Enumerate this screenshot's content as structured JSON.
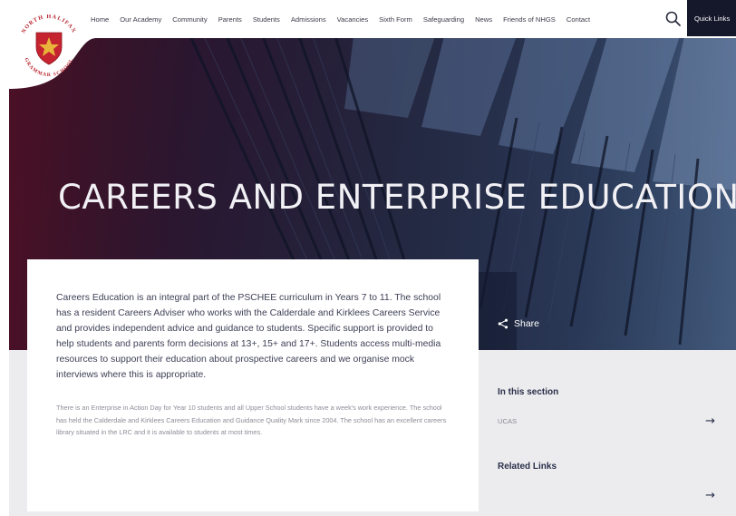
{
  "school": {
    "crest_text_top": "NORTH HALIFAX",
    "crest_text_bottom": "GRAMMAR SCHOOL"
  },
  "nav": {
    "items": [
      "Home",
      "Our Academy",
      "Community",
      "Parents",
      "Students",
      "Admissions",
      "Vacancies",
      "Sixth Form",
      "Safeguarding",
      "News",
      "Friends of NHGS",
      "Contact"
    ],
    "search_icon": "search-icon",
    "quick_links_label": "Quick Links"
  },
  "hero": {
    "title": "CAREERS AND ENTERPRISE EDUCATION"
  },
  "content": {
    "main_text": "Careers Education is an integral part of the PSCHEE curriculum in Years 7 to 11. The school has a resident Careers Adviser who works with the Calderdale and Kirklees Careers Service and provides independent advice and guidance to students. Specific support is provided to help students and parents form decisions at 13+, 15+ and 17+.  Students access multi-media resources to support their education about prospective careers and we organise mock interviews where this is appropriate.",
    "secondary_text": "There is an Enterprise in Action Day for Year 10 students and all Upper School students have a week's work experience. The school has held the Calderdale and Kirklees Careers Education and Guidance Quality Mark since 2004. The school has an excellent careers library situated in the LRC and it is available to students at most times."
  },
  "share": {
    "label": "Share",
    "icon": "share-icon"
  },
  "sidebar": {
    "in_this_section_heading": "In this section",
    "section_links": [
      {
        "label": "UCAS",
        "icon": "arrow-right-icon"
      }
    ],
    "related_links_heading": "Related Links",
    "related_links": [
      {
        "label": "",
        "icon": "arrow-right-icon"
      }
    ]
  },
  "colors": {
    "nav_text": "#3b3b4a",
    "quick_links_bg": "#15172a",
    "crest_red": "#c4232f",
    "hero_dark": "#22263f",
    "heading": "#2a2f4a"
  }
}
